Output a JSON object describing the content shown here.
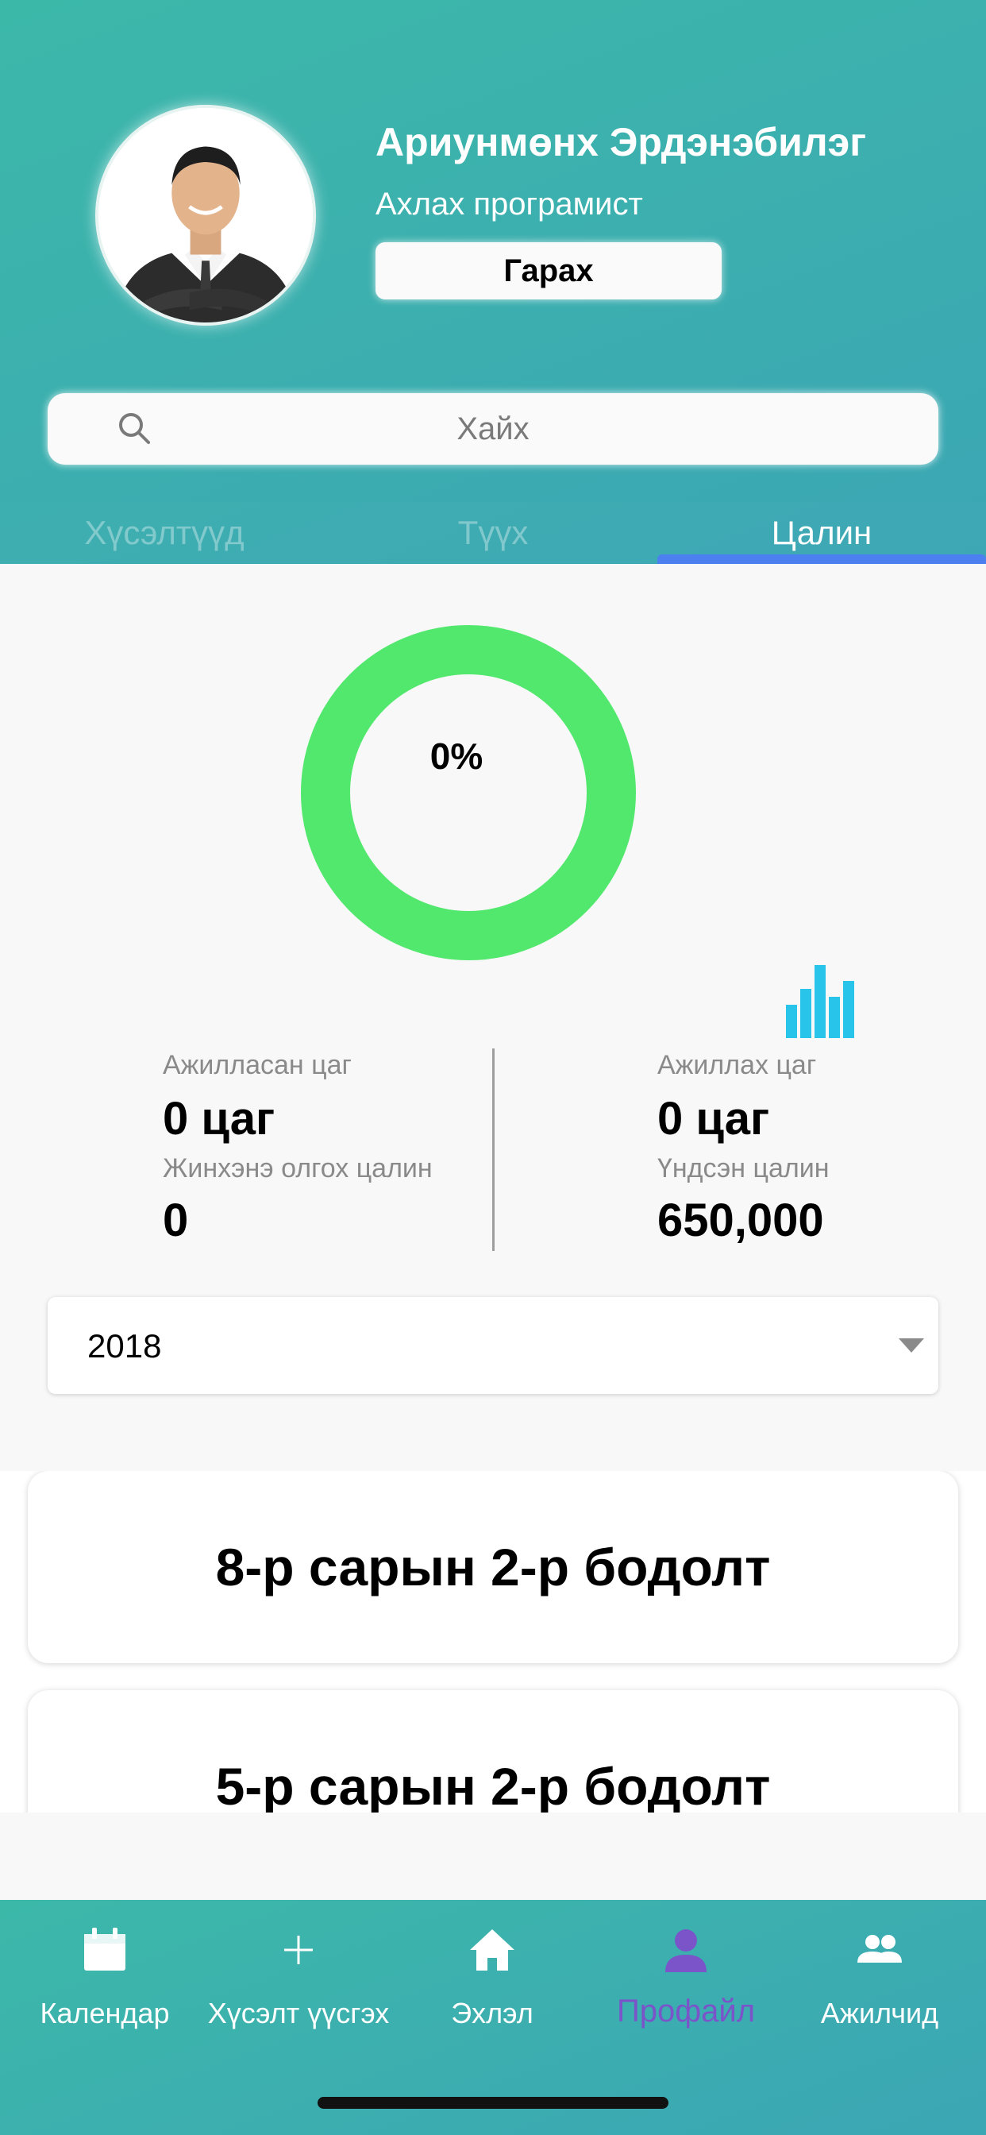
{
  "profile": {
    "name": "Ариунмөнх Эрдэнэбилэг",
    "role": "Ахлах програмист",
    "logout_label": "Гарах",
    "avatar_icon": "person-photo"
  },
  "search": {
    "placeholder": "Хайх"
  },
  "tabs": [
    {
      "label": "Хүсэлтүүд",
      "active": false
    },
    {
      "label": "Түүх",
      "active": false
    },
    {
      "label": "Цалин",
      "active": true
    }
  ],
  "progress": {
    "percent_label": "0%",
    "fraction": 0,
    "ring_color": "#52e86e"
  },
  "stats": {
    "worked_hours_label": "Ажилласан цаг",
    "worked_hours_value": "0 цаг",
    "required_hours_label": "Ажиллах цаг",
    "required_hours_value": "0 цаг",
    "net_salary_label": "Жинхэнэ олгох цалин",
    "net_salary_value": "0",
    "base_salary_label": "Үндсэн цалин",
    "base_salary_value": "650,000"
  },
  "year_select": {
    "value": "2018"
  },
  "payroll_items": [
    {
      "title": "8-р сарын 2-р бодолт"
    },
    {
      "title": "5-р сарын 2-р бодолт"
    }
  ],
  "bottom_nav": [
    {
      "label": "Календар",
      "icon": "calendar-icon",
      "active": false
    },
    {
      "label": "Хүсэлт үүсгэх",
      "icon": "plus-icon",
      "active": false
    },
    {
      "label": "Эхлэл",
      "icon": "home-icon",
      "active": false
    },
    {
      "label": "Профайл",
      "icon": "person-icon",
      "active": true
    },
    {
      "label": "Ажилчид",
      "icon": "people-icon",
      "active": false
    }
  ],
  "colors": {
    "header_gradient_start": "#3cb8a9",
    "header_gradient_end": "#3ba6b4",
    "tab_indicator": "#4c7ff0",
    "active_nav": "#7b54c9",
    "chart_icon": "#29c4ea"
  }
}
